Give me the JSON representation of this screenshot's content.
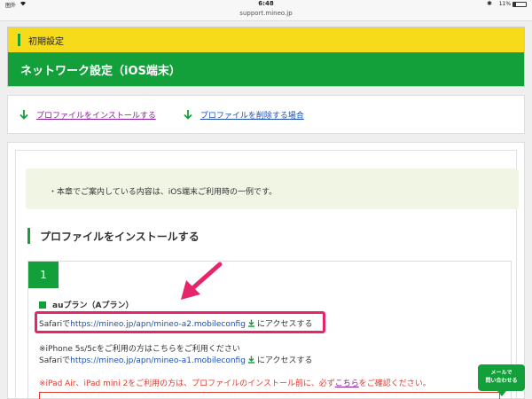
{
  "status_bar": {
    "carrier": "圏外",
    "time": "6:48",
    "battery": "11%",
    "url": "support.mineo.jp"
  },
  "header": {
    "category": "初期設定",
    "title": "ネットワーク設定（iOS端末）"
  },
  "links": {
    "install": "プロファイルをインストールする",
    "delete": "プロファイルを削除する場合"
  },
  "note": "・本章でご案内している内容は、iOS端末ご利用時の一例です。",
  "section": {
    "title": "プロファイルをインストールする",
    "step_number": "1",
    "plan": "auプラン（Aプラン）",
    "line1_prefix": "Safariで",
    "line1_url": "https://mineo.jp/apn/mineo-a2.mobileconfig",
    "line1_suffix": "にアクセスする",
    "line2": "※iPhone 5s/5cをご利用の方はこちらをご利用ください",
    "line3_prefix": "Safariで",
    "line3_url": "https://mineo.jp/apn/mineo-a1.mobileconfig",
    "line3_suffix": "にアクセスする",
    "warn_prefix": "※iPad Air、iPad mini 2をご利用の方は、プロファイルのインストール前に、必ず",
    "warn_link": "こちら",
    "warn_suffix": "をご確認ください。"
  },
  "contact": {
    "line1": "メールで",
    "line2": "問い合わせる"
  },
  "colors": {
    "green": "#13a03a",
    "yellow": "#f5db19",
    "highlight": "#e5266d",
    "link": "#1d4fb3",
    "warn": "#e23a2e"
  }
}
